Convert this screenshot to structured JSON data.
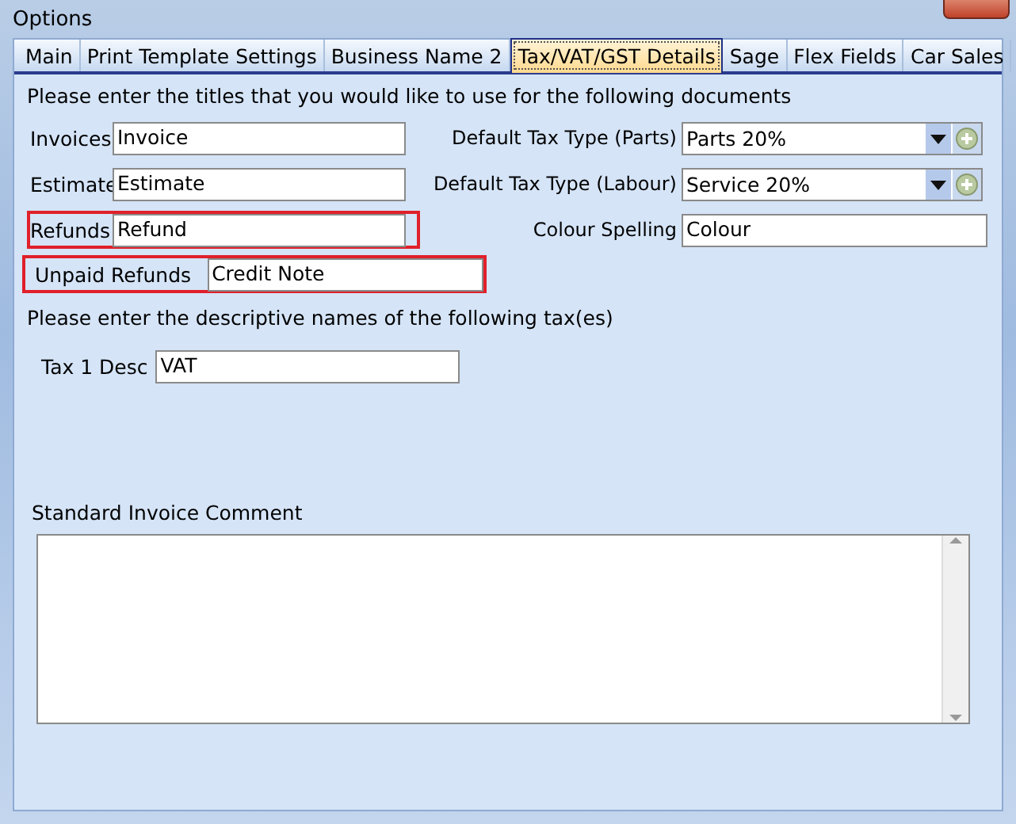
{
  "window": {
    "title": "Options"
  },
  "tabs": [
    {
      "label": "Main",
      "selected": false
    },
    {
      "label": "Print Template Settings",
      "selected": false
    },
    {
      "label": "Business Name 2",
      "selected": false
    },
    {
      "label": "Tax/VAT/GST Details",
      "selected": true
    },
    {
      "label": "Sage",
      "selected": false
    },
    {
      "label": "Flex Fields",
      "selected": false
    },
    {
      "label": "Car Sales",
      "selected": false
    }
  ],
  "titles_intro": "Please enter the titles that you would like to use for the following documents",
  "document_fields": [
    {
      "label": "Invoices",
      "value": "Invoice",
      "highlighted": false
    },
    {
      "label": "Estimate",
      "value": "Estimate",
      "highlighted": false
    },
    {
      "label": "Refunds",
      "value": "Refund",
      "highlighted": true
    },
    {
      "label": "Unpaid Refunds",
      "value": "Credit Note",
      "highlighted": true
    }
  ],
  "settings_fields": [
    {
      "kind": "combo",
      "label": "Default Tax Type (Parts)",
      "value": "Parts 20%"
    },
    {
      "kind": "combo",
      "label": "Default Tax Type (Labour)",
      "value": "Service 20%"
    },
    {
      "kind": "text",
      "label": "Colour Spelling",
      "value": "Colour"
    }
  ],
  "tax_intro": "Please enter the descriptive names of the following tax(es)",
  "tax_fields": [
    {
      "label": "Tax 1 Desc",
      "value": "VAT"
    }
  ],
  "comment": {
    "label": "Standard Invoice Comment"
  }
}
